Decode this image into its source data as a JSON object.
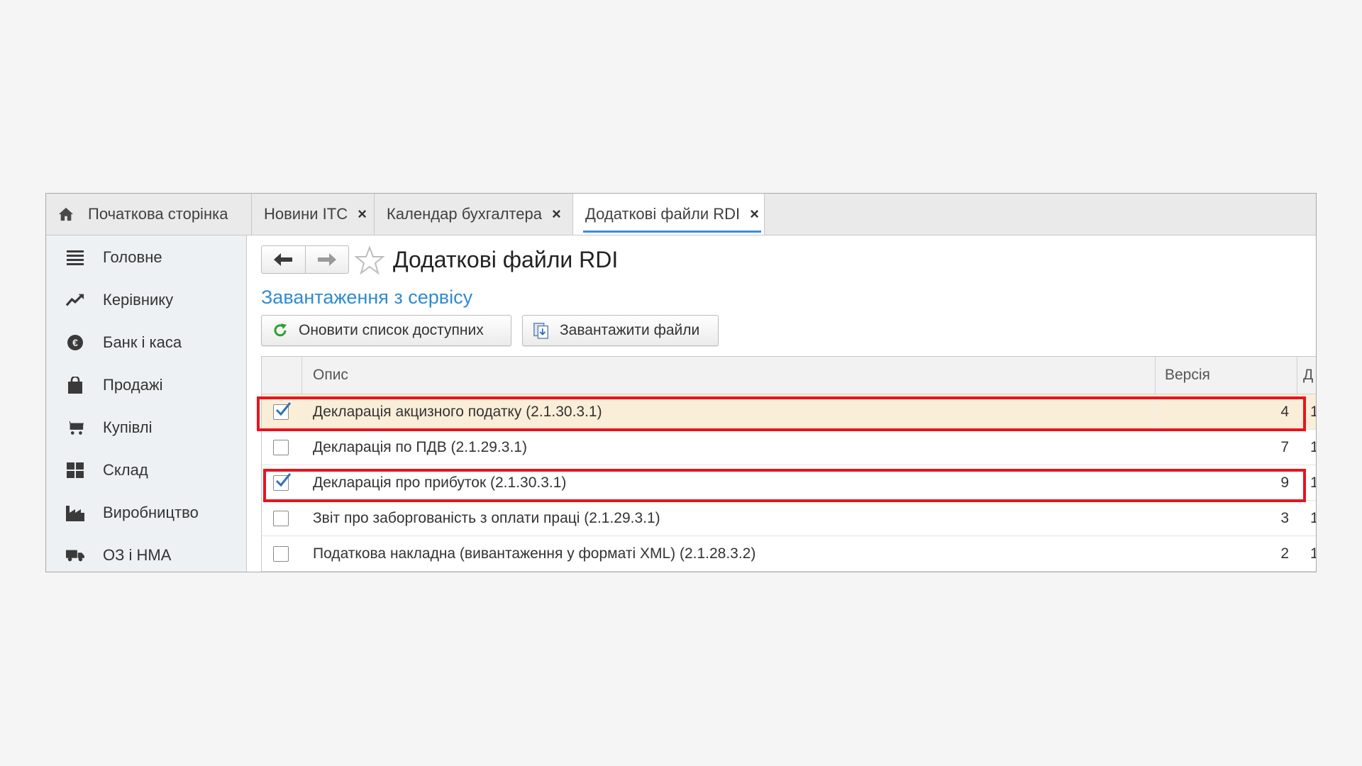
{
  "tabs": [
    {
      "label": "Початкова сторінка",
      "icon": "home-icon",
      "closable": false,
      "active": false
    },
    {
      "label": "Новини ІТС",
      "closable": true,
      "active": false
    },
    {
      "label": "Календар бухгалтера",
      "closable": true,
      "active": false
    },
    {
      "label": "Додаткові файли RDI",
      "closable": true,
      "active": true
    }
  ],
  "tab_close_glyph": "×",
  "sidebar": {
    "items": [
      {
        "label": "Головне",
        "icon": "menu-icon"
      },
      {
        "label": "Керівнику",
        "icon": "trend-icon"
      },
      {
        "label": "Банк і каса",
        "icon": "coin-icon"
      },
      {
        "label": "Продажі",
        "icon": "shopping-bag-icon"
      },
      {
        "label": "Купівлі",
        "icon": "cart-icon"
      },
      {
        "label": "Склад",
        "icon": "warehouse-grid-icon"
      },
      {
        "label": "Виробництво",
        "icon": "factory-icon"
      },
      {
        "label": "ОЗ і НМА",
        "icon": "truck-icon"
      }
    ]
  },
  "page": {
    "title": "Додаткові файли RDI",
    "section_link": "Завантаження з сервісу",
    "refresh_button": "Оновити список доступних",
    "download_button": "Завантажити файли"
  },
  "table": {
    "headers": {
      "description": "Опис",
      "version": "Версія",
      "extra": "Д"
    },
    "rows": [
      {
        "checked": true,
        "description": "Декларація акцизного податку (2.1.30.3.1)",
        "version": "4",
        "extra": "1",
        "selected": true
      },
      {
        "checked": false,
        "description": "Декларація по ПДВ (2.1.29.3.1)",
        "version": "7",
        "extra": "1",
        "selected": false
      },
      {
        "checked": true,
        "description": "Декларація про прибуток (2.1.30.3.1)",
        "version": "9",
        "extra": "1",
        "selected": false
      },
      {
        "checked": false,
        "description": "Звіт про заборгованість з оплати праці (2.1.29.3.1)",
        "version": "3",
        "extra": "1",
        "selected": false
      },
      {
        "checked": false,
        "description": "Податкова накладна (вивантаження у форматі XML) (2.1.28.3.2)",
        "version": "2",
        "extra": "1",
        "selected": false
      }
    ]
  },
  "colors": {
    "accent": "#3b8ed6",
    "link": "#2f8bd0",
    "highlight_border": "#e8141d",
    "selected_row": "#fbeed9"
  }
}
